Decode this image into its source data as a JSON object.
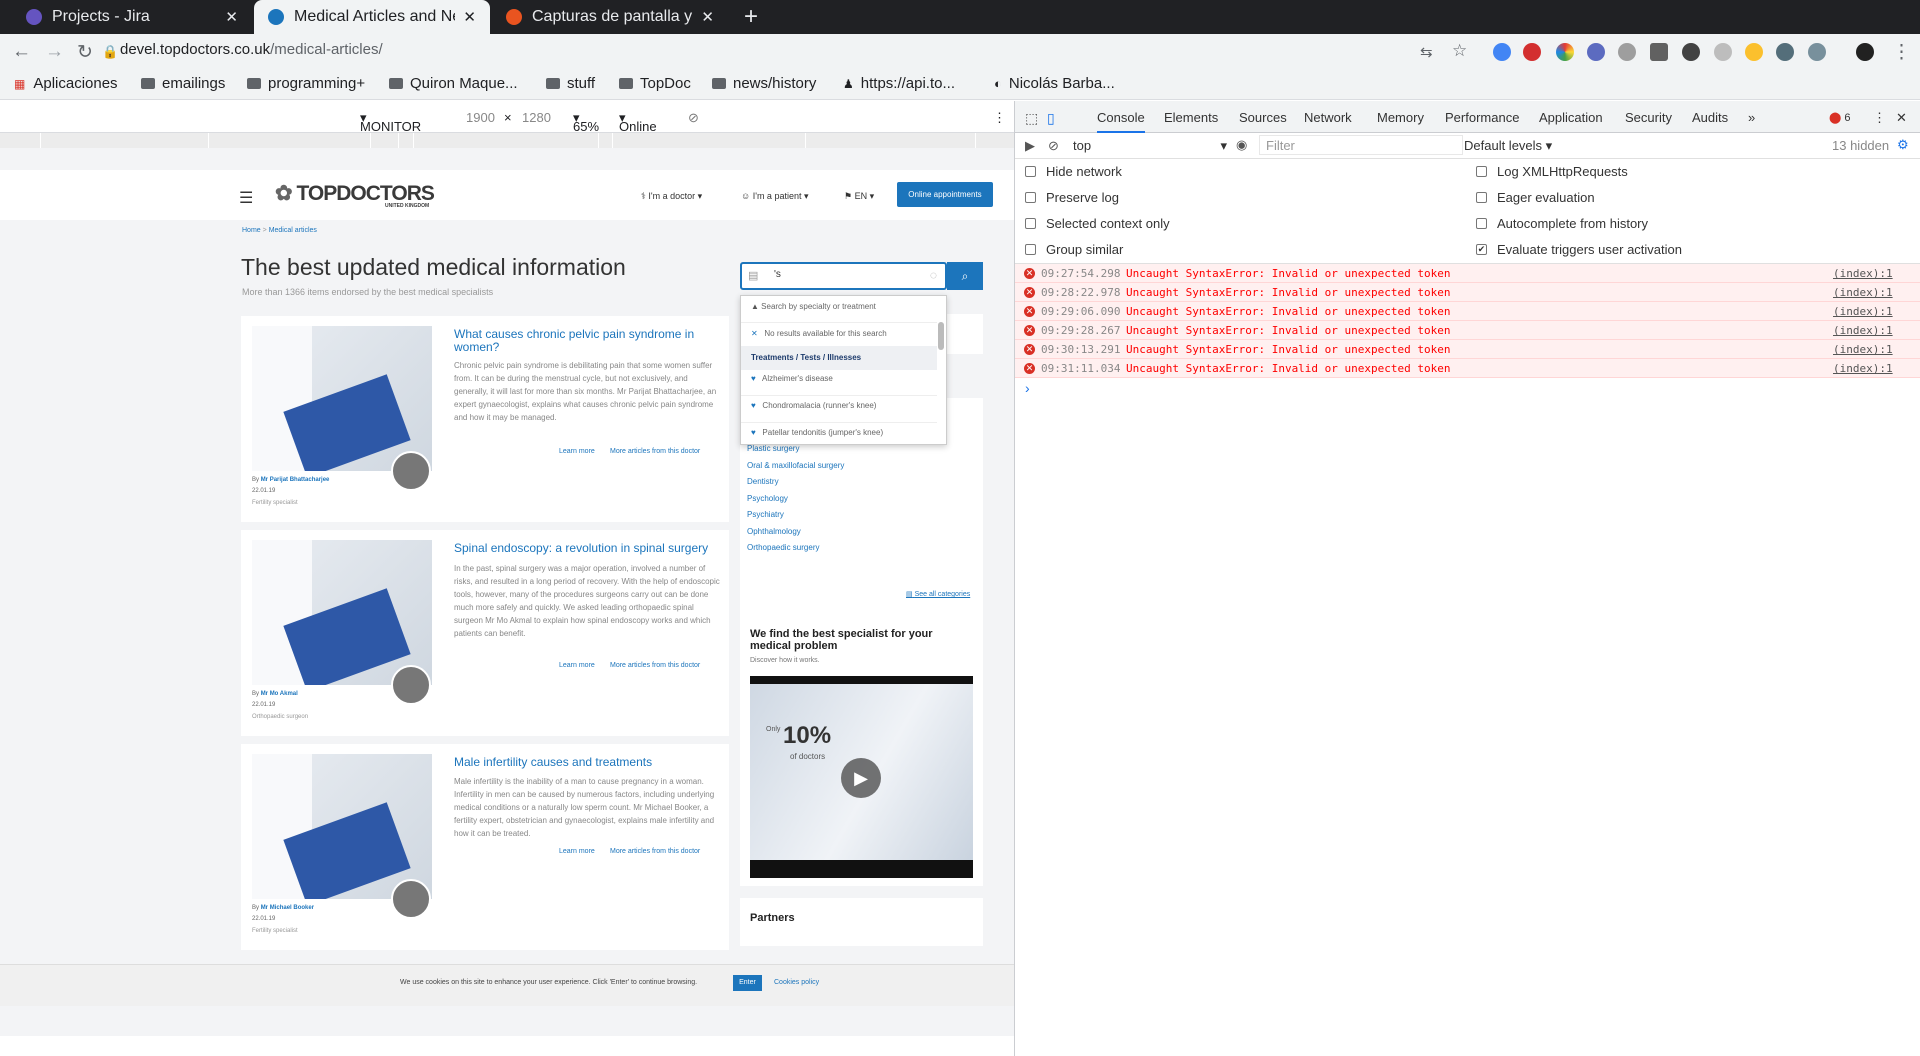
{
  "tabs": [
    {
      "label": "Projects - Jira",
      "icon": "jira-icon"
    },
    {
      "label": "Medical Articles and News",
      "icon": "topdoctors-icon"
    },
    {
      "label": "Capturas de pantalla y gra",
      "icon": "ubuntu-icon"
    }
  ],
  "url": {
    "host": "devel.topdoctors.co.uk",
    "path": "/medical-articles/"
  },
  "bookmarks": [
    "Aplicaciones",
    "emailings",
    "programming+",
    "Quiron Maque...",
    "stuff",
    "TopDoc",
    "news/history",
    "https://api.to...",
    "Nicolás Barba..."
  ],
  "devbar": {
    "device": "MONITOR ...",
    "width": "1900",
    "x": "×",
    "height": "1280",
    "zoom": "65%",
    "network": "Online"
  },
  "site": {
    "logo": "TOPDOCTORS",
    "logo_sub": "UNITED KINGDOM",
    "nav": [
      "I'm a doctor",
      "I'm a patient",
      "EN"
    ],
    "cta": "Online appointments",
    "breadcrumb": {
      "home": "Home",
      "sep": ">",
      "current": "Medical articles"
    },
    "title": "The best updated medical information",
    "subtitle": "More than 1366 items endorsed by the best medical specialists",
    "search_value": "'s",
    "dropdown": {
      "hint": "Search by specialty or treatment",
      "no_results": "No results available for this search",
      "section": "Treatments / Tests / Illnesses",
      "items": [
        "Alzheimer's disease",
        "Chondromalacia (runner's knee)",
        "Patellar tendonitis (jumper's knee)"
      ]
    },
    "categories": [
      "Plastic surgery",
      "Oral & maxillofacial surgery",
      "Dentistry",
      "Psychology",
      "Psychiatry",
      "Ophthalmology",
      "Orthopaedic surgery"
    ],
    "see_all": "See all categories",
    "promo_title": "We find the best specialist for your medical problem",
    "promo_sub": "Discover how it works.",
    "video_only": "Only",
    "video_pct": "10%",
    "video_doctors": "of doctors",
    "partners": "Partners",
    "articles": [
      {
        "title": "What causes chronic pelvic pain syndrome in women?",
        "desc": "Chronic pelvic pain syndrome is debilitating pain that some women suffer from. It can be during the menstrual cycle, but not exclusively, and generally, it will last for more than six months. Mr Parijat Bhattacharjee, an expert gynaecologist, explains what causes chronic pelvic pain syndrome and how it may be managed.",
        "learn": "Learn more",
        "more": "More articles from this doctor",
        "by": "By",
        "author": "Mr Parijat Bhattacharjee",
        "date": "22.01.19",
        "specialty": "Fertility specialist"
      },
      {
        "title": "Spinal endoscopy: a revolution in spinal surgery",
        "desc": "In the past, spinal surgery was a major operation, involved a number of risks, and resulted in a long period of recovery. With the help of endoscopic tools, however, many of the procedures surgeons carry out can be done much more safely and quickly. We asked leading orthopaedic spinal surgeon Mr Mo Akmal to explain how spinal endoscopy works and which patients can benefit.",
        "learn": "Learn more",
        "more": "More articles from this doctor",
        "by": "By",
        "author": "Mr Mo Akmal",
        "date": "22.01.19",
        "specialty": "Orthopaedic surgeon"
      },
      {
        "title": "Male infertility causes and treatments",
        "desc": "Male infertility is the inability of a man to cause pregnancy in a woman. Infertility in men can be caused by numerous factors, including underlying medical conditions or a naturally low sperm count. Mr Michael Booker, a fertility expert, obstetrician and gynaecologist, explains male infertility and how it can be treated.",
        "learn": "Learn more",
        "more": "More articles from this doctor",
        "by": "By",
        "author": "Mr Michael Booker",
        "date": "22.01.19",
        "specialty": "Fertility specialist"
      }
    ],
    "cookie": {
      "text": "We use cookies on this site to enhance your user experience. Click 'Enter' to continue browsing.",
      "enter": "Enter",
      "policy": "Cookies policy"
    }
  },
  "devtools": {
    "tabs": [
      "Console",
      "Elements",
      "Sources",
      "Network",
      "Memory",
      "Performance",
      "Application",
      "Security",
      "Audits"
    ],
    "error_count": "6",
    "context": "top",
    "filter_placeholder": "Filter",
    "levels": "Default levels",
    "hidden": "13 hidden",
    "options_left": [
      "Hide network",
      "Preserve log",
      "Selected context only",
      "Group similar"
    ],
    "options_right": [
      "Log XMLHttpRequests",
      "Eager evaluation",
      "Autocomplete from history",
      "Evaluate triggers user activation"
    ],
    "errors": [
      {
        "time": "09:27:54.298",
        "msg": "Uncaught SyntaxError: Invalid or unexpected token",
        "src": "(index):1"
      },
      {
        "time": "09:28:22.978",
        "msg": "Uncaught SyntaxError: Invalid or unexpected token",
        "src": "(index):1"
      },
      {
        "time": "09:29:06.090",
        "msg": "Uncaught SyntaxError: Invalid or unexpected token",
        "src": "(index):1"
      },
      {
        "time": "09:29:28.267",
        "msg": "Uncaught SyntaxError: Invalid or unexpected token",
        "src": "(index):1"
      },
      {
        "time": "09:30:13.291",
        "msg": "Uncaught SyntaxError: Invalid or unexpected token",
        "src": "(index):1"
      },
      {
        "time": "09:31:11.034",
        "msg": "Uncaught SyntaxError: Invalid or unexpected token",
        "src": "(index):1"
      }
    ],
    "prompt": "›"
  }
}
